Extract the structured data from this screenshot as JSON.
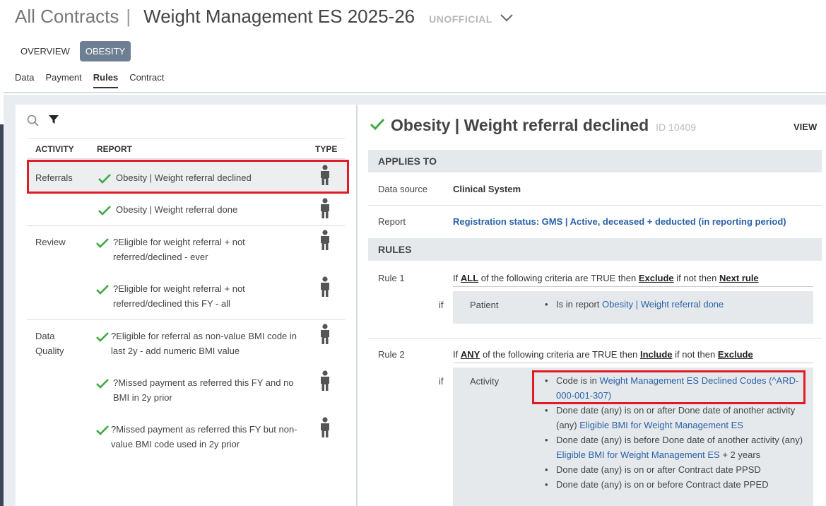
{
  "header": {
    "app_title": "All Contracts",
    "separator": "|",
    "contract_title": "Weight Management ES 2025-26",
    "status": "UNOFFICIAL"
  },
  "pills": [
    {
      "label": "OVERVIEW",
      "active": false
    },
    {
      "label": "OBESITY",
      "active": true
    }
  ],
  "subtabs": [
    {
      "label": "Data",
      "active": false
    },
    {
      "label": "Payment",
      "active": false
    },
    {
      "label": "Rules",
      "active": true
    },
    {
      "label": "Contract",
      "active": false
    }
  ],
  "list": {
    "columns": {
      "activity": "ACTIVITY",
      "report": "REPORT",
      "type": "TYPE"
    },
    "groups": [
      {
        "activity": "Referrals",
        "rows": [
          {
            "report": "Obesity | Weight referral declined",
            "selected": true
          },
          {
            "report": "Obesity | Weight referral done",
            "selected": false
          }
        ]
      },
      {
        "activity": "Review",
        "rows": [
          {
            "report_line1": "?Eligible for weight referral + not",
            "report_line2": "referred/declined - ever"
          },
          {
            "report_line1": "?Eligible for weight referral + not",
            "report_line2": "referred/declined this FY - all"
          }
        ]
      },
      {
        "activity_line1": "Data",
        "activity_line2": "Quality",
        "rows": [
          {
            "report_line1": "?Eligible for referral as non-value BMI code in",
            "report_line2": "last 2y - add numeric BMI value"
          },
          {
            "report_line1": "?Missed payment as referred this FY and no",
            "report_line2": "BMI in 2y prior"
          },
          {
            "report_line1": "?Missed payment as referred this FY but non-",
            "report_line2": "value BMI code used in 2y prior"
          }
        ]
      }
    ]
  },
  "detail": {
    "title": "Obesity | Weight referral declined",
    "id": "ID 10409",
    "view_label": "VIEW",
    "applies_to": {
      "heading": "APPLIES TO",
      "data_source_label": "Data source",
      "data_source_value": "Clinical System",
      "report_label": "Report",
      "report_value": "Registration status: GMS | Active, deceased + deducted (in reporting period)"
    },
    "rules_heading": "RULES",
    "rule1": {
      "label": "Rule 1",
      "prefix": "If",
      "quantifier": "ALL",
      "mid": "of the following criteria are TRUE then",
      "action": "Exclude",
      "else_text": "if not then",
      "else_action": "Next rule",
      "if_word": "if",
      "criteria_label": "Patient",
      "criteria": {
        "text": "Is in report",
        "link": "Obesity | Weight referral done"
      }
    },
    "rule2": {
      "label": "Rule 2",
      "prefix": "If",
      "quantifier": "ANY",
      "mid": "of the following criteria are TRUE then",
      "action": "Include",
      "else_text": "if not then",
      "else_action": "Exclude",
      "if_word": "if",
      "criteria_label": "Activity",
      "criteria": [
        {
          "text": "Code is in",
          "link": "Weight Management ES Declined Codes (^ARD-000-001-307)"
        },
        {
          "text": "Done date (any) is on or after Done date of another activity (any)",
          "link": "Eligible BMI for Weight Management ES"
        },
        {
          "text": "Done date (any) is before Done date of another activity (any)",
          "link": "Eligible BMI for Weight Management ES",
          "suffix": "+ 2 years"
        },
        {
          "text": "Done date (any) is on or after Contract date PPSD"
        },
        {
          "text": "Done date (any) is on or before Contract date PPED"
        }
      ]
    }
  },
  "colors": {
    "check_green": "#3fa844",
    "link_blue": "#2a62a8",
    "highlight_red": "#e01b24",
    "pill_active": "#6f7f93"
  }
}
